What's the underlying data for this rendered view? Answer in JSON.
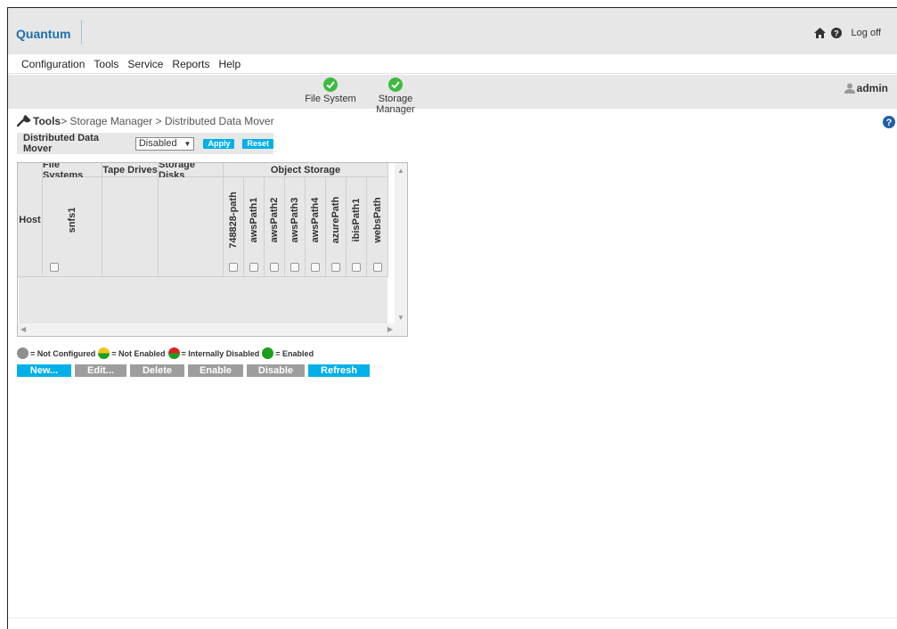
{
  "header": {
    "logo": "Quantum",
    "logoff": "Log off"
  },
  "menu": [
    "Configuration",
    "Tools",
    "Service",
    "Reports",
    "Help"
  ],
  "status": {
    "file_system": "File System",
    "storage_manager": "Storage Manager",
    "user": "admin"
  },
  "breadcrumb": {
    "root": "Tools",
    "path": "> Storage Manager > Distributed Data Mover"
  },
  "ddm": {
    "label": "Distributed Data Mover",
    "selected": "Disabled",
    "apply": "Apply",
    "reset": "Reset"
  },
  "grid": {
    "host_header": "Host",
    "groups": [
      "File Systems",
      "Tape Drives",
      "Storage Disks",
      "Object Storage"
    ],
    "file_systems": [
      "snfs1"
    ],
    "object_storage": [
      "748828-path",
      "awsPath1",
      "awsPath2",
      "awsPath3",
      "awsPath4",
      "azurePath",
      "ibisPath1",
      "websPath"
    ]
  },
  "legend": {
    "not_configured": "= Not Configured",
    "not_enabled": "= Not Enabled",
    "internally_disabled": "= Internally Disabled",
    "enabled": "= Enabled"
  },
  "actions": {
    "new": "New...",
    "edit": "Edit...",
    "delete": "Delete",
    "enable": "Enable",
    "disable": "Disable",
    "refresh": "Refresh"
  },
  "colors": {
    "accent": "#00b0e8",
    "brand": "#1f6fb0",
    "enabled": "#1e9e1e",
    "disabled_btn": "#9d9d9d"
  },
  "icons": [
    "home-icon",
    "help-icon",
    "check-circle-icon",
    "user-icon",
    "wrench-icon",
    "question-circle-icon"
  ]
}
